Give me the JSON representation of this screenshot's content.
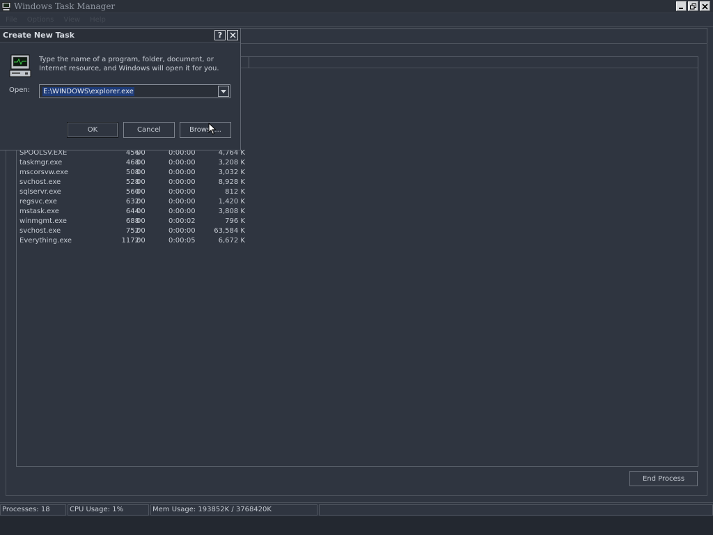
{
  "window": {
    "title": "Windows Task Manager",
    "menu": [
      "File",
      "Options",
      "View",
      "Help"
    ]
  },
  "processes": [
    {
      "name": "SPOOLSV.EXE",
      "pid": "456",
      "cpu": "00",
      "cpu_time": "0:00:00",
      "mem": "4,764 K"
    },
    {
      "name": "taskmgr.exe",
      "pid": "468",
      "cpu": "00",
      "cpu_time": "0:00:00",
      "mem": "3,208 K"
    },
    {
      "name": "mscorsvw.exe",
      "pid": "508",
      "cpu": "00",
      "cpu_time": "0:00:00",
      "mem": "3,032 K"
    },
    {
      "name": "svchost.exe",
      "pid": "528",
      "cpu": "00",
      "cpu_time": "0:00:00",
      "mem": "8,928 K"
    },
    {
      "name": "sqlservr.exe",
      "pid": "560",
      "cpu": "00",
      "cpu_time": "0:00:00",
      "mem": "812 K"
    },
    {
      "name": "regsvc.exe",
      "pid": "632",
      "cpu": "00",
      "cpu_time": "0:00:00",
      "mem": "1,420 K"
    },
    {
      "name": "mstask.exe",
      "pid": "644",
      "cpu": "00",
      "cpu_time": "0:00:00",
      "mem": "3,808 K"
    },
    {
      "name": "winmgmt.exe",
      "pid": "688",
      "cpu": "00",
      "cpu_time": "0:00:02",
      "mem": "796 K"
    },
    {
      "name": "svchost.exe",
      "pid": "752",
      "cpu": "00",
      "cpu_time": "0:00:00",
      "mem": "63,584 K"
    },
    {
      "name": "Everything.exe",
      "pid": "1172",
      "cpu": "00",
      "cpu_time": "0:00:05",
      "mem": "6,672 K"
    }
  ],
  "end_process_label": "End Process",
  "status": {
    "processes": "Processes: 18",
    "cpu": "CPU Usage: 1%",
    "mem": "Mem Usage: 193852K / 3768420K"
  },
  "dialog": {
    "title": "Create New Task",
    "help_label": "?",
    "description": "Type the name of a program, folder, document, or Internet resource, and Windows will open it for you.",
    "open_label": "Open:",
    "open_value": "E:\\WINDOWS\\explorer.exe",
    "ok_label": "OK",
    "cancel_label": "Cancel",
    "browse_label": "Browse..."
  }
}
